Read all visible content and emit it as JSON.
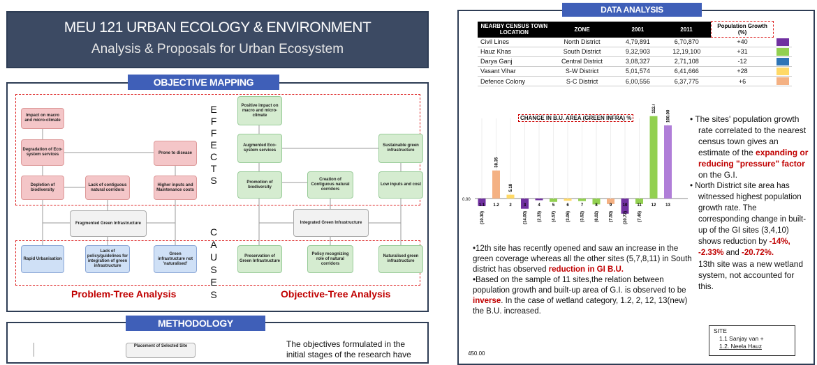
{
  "header": {
    "title": "MEU 121 URBAN ECOLOGY & ENVIRONMENT",
    "subtitle": "Analysis & Proposals for Urban Ecosystem"
  },
  "objective_mapping": {
    "heading": "OBJECTIVE MAPPING",
    "effects_letters": [
      "E",
      "F",
      "F",
      "E",
      "C",
      "T",
      "S"
    ],
    "causes_letters": [
      "C",
      "A",
      "U",
      "S",
      "E",
      "S"
    ],
    "problem_tree": {
      "label": "Problem-Tree Analysis",
      "effects": [
        "Impact on macro and micro-climate",
        "Degradation of Eco-system services",
        "Prone to disease",
        "Depletion of biodiversity",
        "Lack of contiguous natural corridors",
        "Higher inputs and Maintenance costs"
      ],
      "core": "Fragmented Green Infrastructure",
      "causes": [
        "Rapid Urbanisation",
        "Lack of policy/guidelines for integration of green infrastructure",
        "Green infrastructure not 'naturalised'"
      ]
    },
    "objective_tree": {
      "label": "Objective-Tree Analysis",
      "effects": [
        "Positive impact on macro and micro-climate",
        "Augmented Eco-system services",
        "Sustainable green infrastructure",
        "Promotion of biodiversity",
        "Creation of Contiguous natural corridors",
        "Low inputs and cost"
      ],
      "core": "Integrated Green Infrastructure",
      "causes": [
        "Preservation of Green Infrastructure",
        "Policy recognizing role of natural corridors",
        "Naturalised green infrastructure"
      ]
    }
  },
  "methodology": {
    "heading": "METHODOLOGY",
    "box_text": "Placement of Selected Site",
    "text": "The objectives formulated in the initial stages of the research have"
  },
  "data_analysis": {
    "heading": "DATA ANALYSIS",
    "table": {
      "headers": [
        "NEARBY CENSUS TOWN LOCATION",
        "ZONE",
        "2001",
        "2011",
        "Population Growth (%)"
      ],
      "rows": [
        {
          "loc": "Civil Lines",
          "zone": "North District",
          "y2001": "4,79,891",
          "y2011": "6,70,870",
          "growth": "+40",
          "color": "#7030a0"
        },
        {
          "loc": "Hauz Khas",
          "zone": "South District",
          "y2001": "9,32,903",
          "y2011": "12,19,100",
          "growth": "+31",
          "color": "#92d050"
        },
        {
          "loc": "Darya Ganj",
          "zone": "Central District",
          "y2001": "3,08,327",
          "y2011": "2,71,108",
          "growth": "-12",
          "color": "#2e75b6"
        },
        {
          "loc": "Vasant Vihar",
          "zone": "S-W District",
          "y2001": "5,01,574",
          "y2011": "6,41,666",
          "growth": "+28",
          "color": "#ffd966"
        },
        {
          "loc": "Defence Colony",
          "zone": "S-C District",
          "y2001": "6,00,556",
          "y2011": "6,37,775",
          "growth": "+6",
          "color": "#f4b183"
        }
      ]
    },
    "notes_left": [
      "•12th  site has recently opened and saw an increase in the green coverage whereas all the other sites (5,7,8,11) in South district has observed ",
      "reduction in GI B.U.",
      "•Based on the sample of 11 sites,the relation between population growth and built-up area of G.I. is observed to be ",
      "inverse",
      ". In the case of wetland category, 1.2, 2, 12, 13(new) the B.U. increased."
    ],
    "notes_right": {
      "p1a": "The sites' population growth rate correlated to the nearest census town gives an estimate of the ",
      "p1b": "expanding or reducing \"pressure\" factor",
      "p1c": " on the G.I.",
      "p2a": "North District site area has witnessed highest population growth rate. The corresponding change in built- up of the GI sites (3,4,10) shows reduction by ",
      "p2b": "-14%, -2.33%",
      "p2c": " and ",
      "p2d": "-20.72%.",
      "p3": "13th site was a new wetland system, not accounted for this."
    },
    "site_legend": {
      "title": "SITE",
      "items": [
        "1.1 Sanjay van +",
        "1.2. Neela Hauz"
      ]
    },
    "bottom_axis_label": "450.00"
  },
  "chart_data": {
    "type": "bar",
    "title": "CHANGE IN B.U. AREA (GREEN INFRA) %",
    "categories": [
      "1.1",
      "1.2",
      "2",
      "3",
      "4",
      "5",
      "6",
      "7",
      "8",
      "9",
      "10",
      "11",
      "12",
      "13"
    ],
    "values": [
      -10.3,
      38.35,
      5.18,
      -14.0,
      -2.33,
      -4.57,
      -3.06,
      -3.52,
      -8.02,
      -7.5,
      -20.72,
      -7.46,
      112.65,
      100.0
    ],
    "value_labels": [
      "(10.30)",
      "38.35",
      "5.18",
      "(14.00)",
      "(2.33)",
      "(4.57)",
      "(3.06)",
      "(3.52)",
      "(8.02)",
      "(7.50)",
      "(20.72)",
      "(7.46)",
      "112.65",
      "100.00"
    ],
    "colors": [
      "#7030a0",
      "#f4b183",
      "#ffd966",
      "#7030a0",
      "#7030a0",
      "#92d050",
      "#ffd966",
      "#92d050",
      "#92d050",
      "#f4b183",
      "#7030a0",
      "#92d050",
      "#92d050",
      "#b07ed8"
    ],
    "zero_label": "0.00",
    "ylim": [
      -30,
      120
    ]
  }
}
